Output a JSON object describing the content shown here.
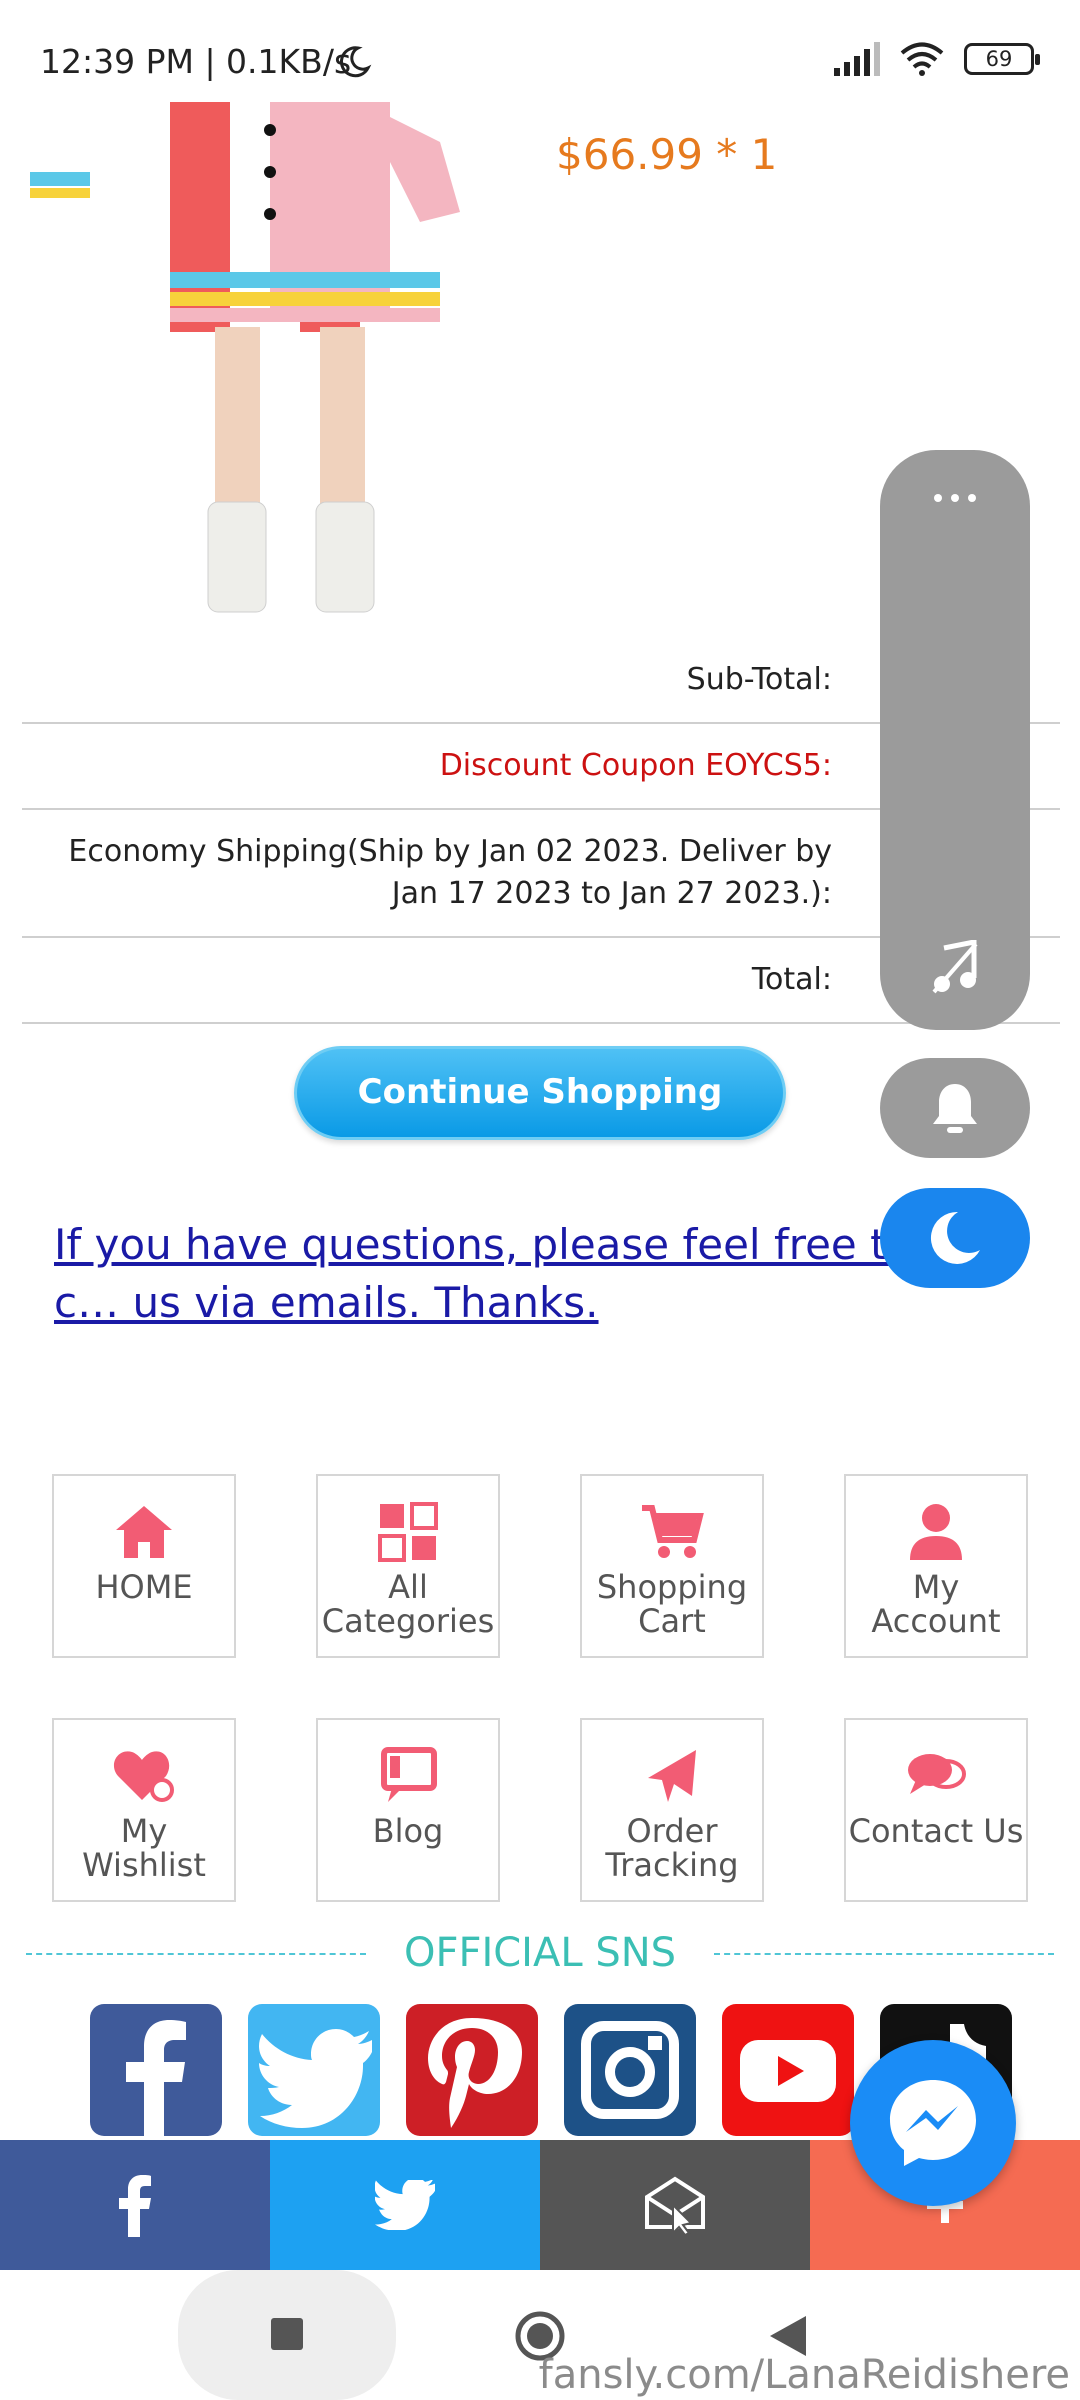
{
  "status": {
    "time": "12:39 PM | 0.1KB/s",
    "battery": "69"
  },
  "product": {
    "price": "$66.99 * 1"
  },
  "totals": {
    "subtotal_label": "Sub-Total:",
    "subtotal_value": "$",
    "coupon_label": "Discount Coupon EOYCS5:",
    "coupon_value": "-",
    "shipping_label": "Economy Shipping(Ship by Jan 02 2023. Deliver by Jan 17 2023 to Jan 27 2023.):",
    "total_label": "Total:",
    "total_value": "$"
  },
  "continue_label": "Continue Shopping",
  "questions_text": "If you have questions, please feel free to c… us via emails. Thanks.",
  "tiles": [
    {
      "label": "HOME",
      "icon": "home-icon"
    },
    {
      "label": "All Categories",
      "icon": "categories-icon"
    },
    {
      "label": "Shopping Cart",
      "icon": "cart-icon"
    },
    {
      "label": "My Account",
      "icon": "user-icon"
    },
    {
      "label": "My Wishlist",
      "icon": "heart-icon"
    },
    {
      "label": "Blog",
      "icon": "blog-icon"
    },
    {
      "label": "Order Tracking",
      "icon": "plane-icon"
    },
    {
      "label": "Contact Us",
      "icon": "chat-icon"
    }
  ],
  "sns_title": "OFFICIAL SNS",
  "sns": [
    "facebook",
    "twitter",
    "pinterest",
    "instagram",
    "youtube",
    "tiktok"
  ],
  "share": [
    "facebook",
    "twitter",
    "email",
    "plus"
  ],
  "watermark": "fansly.com/LanaReidishere",
  "colors": {
    "accent": "#f25c74",
    "price": "#e67a1e",
    "link": "#1a1aa6",
    "sns": "#3bbfb4"
  }
}
